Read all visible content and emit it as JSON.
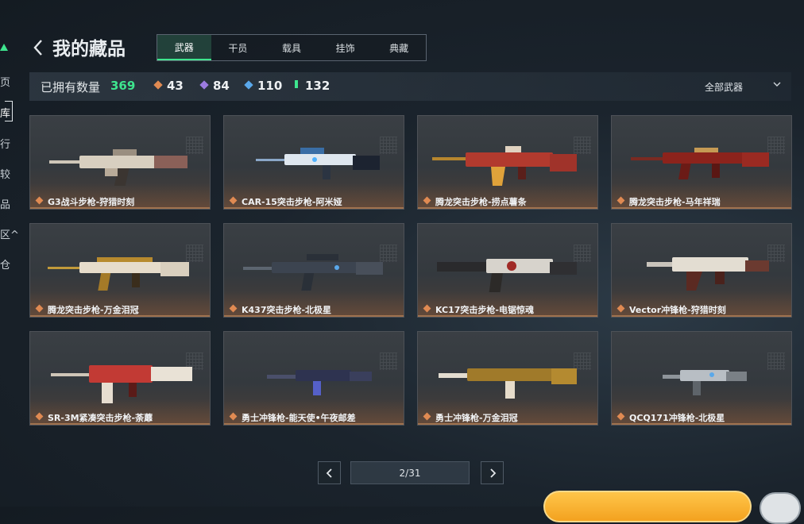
{
  "sidebar": {
    "items": [
      {
        "label": "页"
      },
      {
        "label": "库"
      },
      {
        "label": "行"
      },
      {
        "label": "较"
      },
      {
        "label": "品"
      },
      {
        "label": "区^"
      },
      {
        "label": "仓"
      }
    ],
    "accent": "#3ee58e"
  },
  "header": {
    "title": "我的藏品",
    "back_icon": "chevron-left-icon"
  },
  "tabs": [
    {
      "label": "武器",
      "active": true
    },
    {
      "label": "干员",
      "active": false
    },
    {
      "label": "载具",
      "active": false
    },
    {
      "label": "挂饰",
      "active": false
    },
    {
      "label": "典藏",
      "active": false
    }
  ],
  "stats": {
    "owned_label": "已拥有数量",
    "owned_count": "369",
    "rarities": [
      {
        "value": "43",
        "color": "#e08a52"
      },
      {
        "value": "84",
        "color": "#9b7be0"
      },
      {
        "value": "110",
        "color": "#5aa8ea"
      },
      {
        "value": "132",
        "color": "#3ee58e"
      }
    ],
    "filter_label": "全部武器"
  },
  "items": [
    {
      "name": "G3战斗步枪-狩猎时刻"
    },
    {
      "name": "CAR-15突击步枪-阿米娅"
    },
    {
      "name": "腾龙突击步枪-捞点薯条"
    },
    {
      "name": "腾龙突击步枪-马年祥瑞"
    },
    {
      "name": "腾龙突击步枪-万金泪冠"
    },
    {
      "name": "K437突击步枪-北极星"
    },
    {
      "name": "KC17突击步枪-电锯惊魂"
    },
    {
      "name": "Vector冲锋枪-狩猎时刻"
    },
    {
      "name": "SR-3M紧凑突击步枪-荼蘼"
    },
    {
      "name": "勇士冲锋枪-能天使•午夜邮差"
    },
    {
      "name": "勇士冲锋枪-万金泪冠"
    },
    {
      "name": "QCQ171冲锋枪-北极星"
    }
  ],
  "pagination": {
    "current": 2,
    "total": 31,
    "display": "2/31"
  }
}
